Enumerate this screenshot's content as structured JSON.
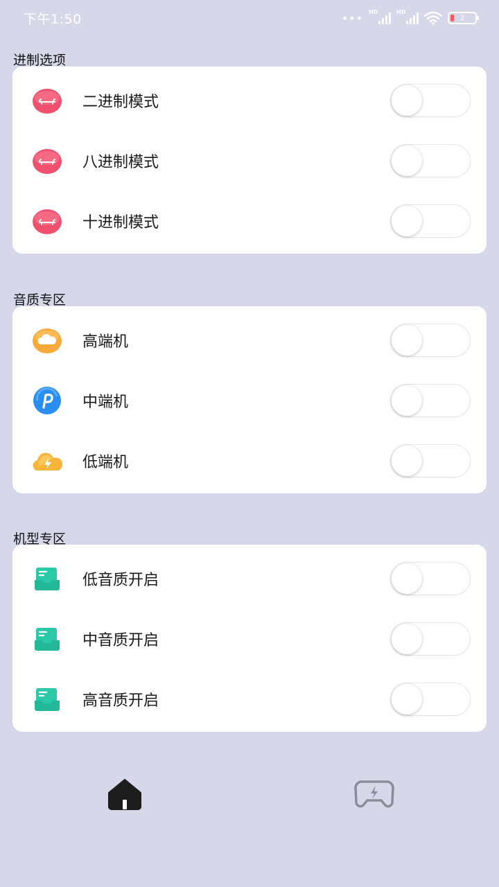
{
  "status_bar": {
    "time": "下午1:50",
    "signal_dots": "•••",
    "hd_label": "HD",
    "battery_level": "2",
    "colors": {
      "text": "#ffffff",
      "battery_low": "#ff5a5a"
    }
  },
  "sections": [
    {
      "title": "进制选项",
      "items": [
        {
          "label": "二进制模式",
          "icon": "pink-sheep-icon",
          "enabled": false
        },
        {
          "label": "八进制模式",
          "icon": "pink-sheep-icon",
          "enabled": false
        },
        {
          "label": "十进制模式",
          "icon": "pink-sheep-icon",
          "enabled": false
        }
      ]
    },
    {
      "title": "音质专区",
      "items": [
        {
          "label": "高端机",
          "icon": "cloud-icon",
          "enabled": false
        },
        {
          "label": "中端机",
          "icon": "blue-p-icon",
          "enabled": false
        },
        {
          "label": "低端机",
          "icon": "lightning-cloud-icon",
          "enabled": false
        }
      ]
    },
    {
      "title": "机型专区",
      "items": [
        {
          "label": "低音质开启",
          "icon": "teal-inbox-icon",
          "enabled": false
        },
        {
          "label": "中音质开启",
          "icon": "teal-inbox-icon",
          "enabled": false
        },
        {
          "label": "高音质开启",
          "icon": "teal-inbox-icon",
          "enabled": false
        }
      ]
    }
  ],
  "bottom_nav": {
    "items": [
      {
        "icon": "home-icon",
        "active": true
      },
      {
        "icon": "gamepad-icon",
        "active": false
      }
    ]
  },
  "colors": {
    "background": "#d6d8e9",
    "card": "#ffffff",
    "pink": "#f0506e",
    "orange": "#f7a93a",
    "blue": "#2a8ef0",
    "teal": "#2cc9a8",
    "nav_active": "#1c1c1c",
    "nav_inactive": "#8a8d99"
  }
}
